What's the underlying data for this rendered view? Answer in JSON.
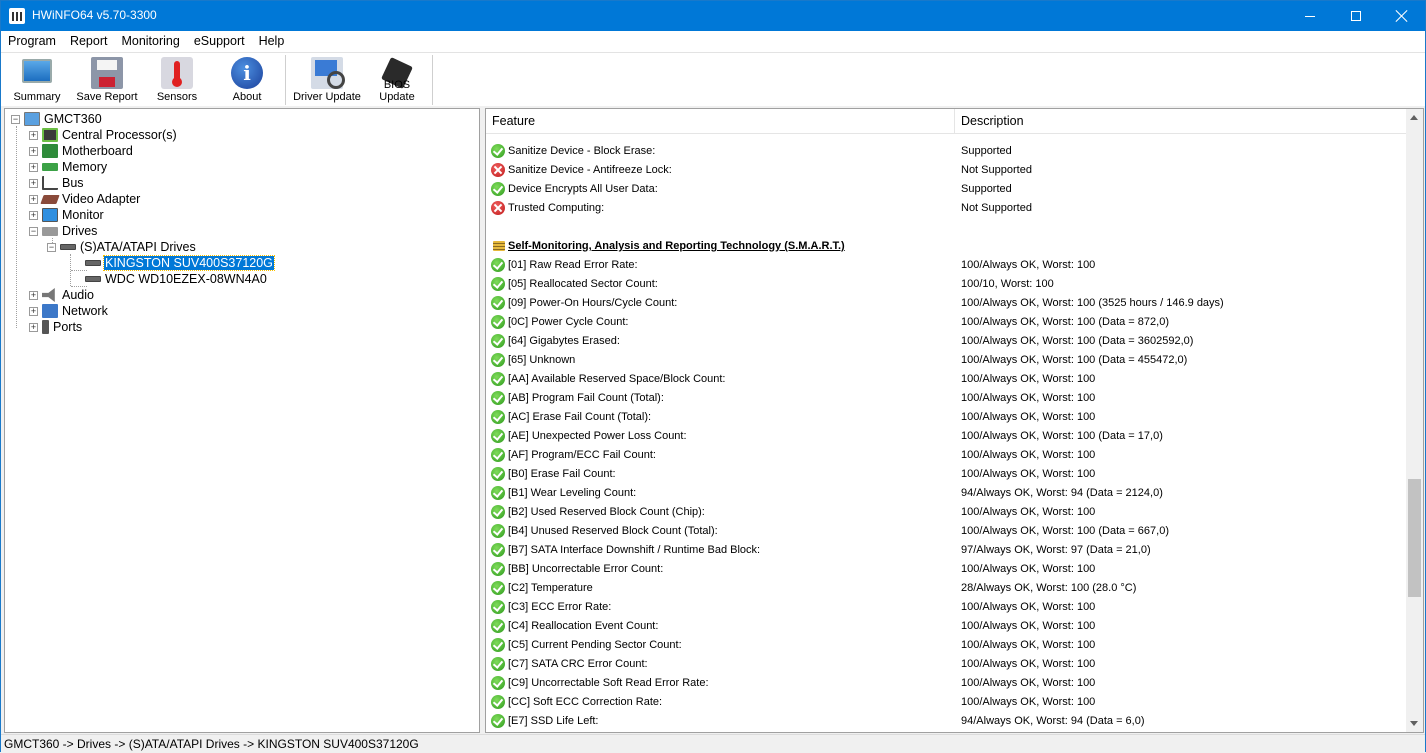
{
  "window": {
    "title": "HWiNFO64 v5.70-3300",
    "controls": [
      "minimize",
      "maximize",
      "close"
    ]
  },
  "menu": [
    "Program",
    "Report",
    "Monitoring",
    "eSupport",
    "Help"
  ],
  "toolbar": {
    "buttons": [
      {
        "label": "Summary",
        "icon": "monitor-icon"
      },
      {
        "label": "Save Report",
        "icon": "floppy-icon"
      },
      {
        "label": "Sensors",
        "icon": "thermometer-icon"
      },
      {
        "label": "About",
        "icon": "info-icon"
      },
      {
        "label": "Driver Update",
        "icon": "driver-update-icon"
      },
      {
        "label": "BIOS Update",
        "icon": "chip-icon"
      }
    ]
  },
  "tree": {
    "root": "GMCT360",
    "items": [
      {
        "label": "Central Processor(s)",
        "icon": "cpu-icon"
      },
      {
        "label": "Motherboard",
        "icon": "motherboard-icon"
      },
      {
        "label": "Memory",
        "icon": "memory-icon"
      },
      {
        "label": "Bus",
        "icon": "bus-icon"
      },
      {
        "label": "Video Adapter",
        "icon": "video-card-icon"
      },
      {
        "label": "Monitor",
        "icon": "monitor-icon"
      },
      {
        "label": "Drives",
        "icon": "drives-icon"
      },
      {
        "label": "(S)ATA/ATAPI Drives",
        "icon": "drive-icon"
      },
      {
        "label": "KINGSTON SUV400S37120G",
        "icon": "drive-icon",
        "selected": true
      },
      {
        "label": "WDC WD10EZEX-08WN4A0",
        "icon": "drive-icon"
      },
      {
        "label": "Audio",
        "icon": "speaker-icon"
      },
      {
        "label": "Network",
        "icon": "network-icon"
      },
      {
        "label": "Ports",
        "icon": "port-icon"
      }
    ]
  },
  "detail": {
    "columns": [
      "Feature",
      "Description"
    ],
    "rows": [
      {
        "status": "ok",
        "feature": "Sanitize Device - Block Erase:",
        "desc": "Supported"
      },
      {
        "status": "bad",
        "feature": "Sanitize Device - Antifreeze Lock:",
        "desc": "Not Supported"
      },
      {
        "status": "ok",
        "feature": "Device Encrypts All User Data:",
        "desc": "Supported"
      },
      {
        "status": "bad",
        "feature": "Trusted Computing:",
        "desc": "Not Supported"
      },
      {
        "status": "none",
        "feature": "",
        "desc": ""
      },
      {
        "status": "section",
        "feature": "Self-Monitoring, Analysis and Reporting Technology (S.M.A.R.T.)",
        "desc": ""
      },
      {
        "status": "ok",
        "feature": "[01] Raw Read Error Rate:",
        "desc": "100/Always OK, Worst: 100"
      },
      {
        "status": "ok",
        "feature": "[05] Reallocated Sector Count:",
        "desc": "100/10, Worst: 100"
      },
      {
        "status": "ok",
        "feature": "[09] Power-On Hours/Cycle Count:",
        "desc": "100/Always OK, Worst: 100 (3525 hours / 146.9 days)"
      },
      {
        "status": "ok",
        "feature": "[0C] Power Cycle Count:",
        "desc": "100/Always OK, Worst: 100 (Data = 872,0)"
      },
      {
        "status": "ok",
        "feature": "[64] Gigabytes Erased:",
        "desc": "100/Always OK, Worst: 100 (Data = 3602592,0)"
      },
      {
        "status": "ok",
        "feature": "[65] Unknown",
        "desc": "100/Always OK, Worst: 100 (Data = 455472,0)"
      },
      {
        "status": "ok",
        "feature": "[AA] Available Reserved Space/Block Count:",
        "desc": "100/Always OK, Worst: 100"
      },
      {
        "status": "ok",
        "feature": "[AB] Program Fail Count (Total):",
        "desc": "100/Always OK, Worst: 100"
      },
      {
        "status": "ok",
        "feature": "[AC] Erase Fail Count (Total):",
        "desc": "100/Always OK, Worst: 100"
      },
      {
        "status": "ok",
        "feature": "[AE] Unexpected Power Loss Count:",
        "desc": "100/Always OK, Worst: 100 (Data = 17,0)"
      },
      {
        "status": "ok",
        "feature": "[AF] Program/ECC Fail Count:",
        "desc": "100/Always OK, Worst: 100"
      },
      {
        "status": "ok",
        "feature": "[B0] Erase Fail Count:",
        "desc": "100/Always OK, Worst: 100"
      },
      {
        "status": "ok",
        "feature": "[B1] Wear Leveling Count:",
        "desc": "94/Always OK, Worst: 94 (Data = 2124,0)"
      },
      {
        "status": "ok",
        "feature": "[B2] Used Reserved Block Count (Chip):",
        "desc": "100/Always OK, Worst: 100"
      },
      {
        "status": "ok",
        "feature": "[B4] Unused Reserved Block Count (Total):",
        "desc": "100/Always OK, Worst: 100 (Data = 667,0)"
      },
      {
        "status": "ok",
        "feature": "[B7] SATA Interface Downshift / Runtime Bad Block:",
        "desc": "97/Always OK, Worst: 97 (Data = 21,0)"
      },
      {
        "status": "ok",
        "feature": "[BB] Uncorrectable Error Count:",
        "desc": "100/Always OK, Worst: 100"
      },
      {
        "status": "ok",
        "feature": "[C2] Temperature",
        "desc": "28/Always OK, Worst: 100 (28.0 °C)"
      },
      {
        "status": "ok",
        "feature": "[C3] ECC Error Rate:",
        "desc": "100/Always OK, Worst: 100"
      },
      {
        "status": "ok",
        "feature": "[C4] Reallocation Event Count:",
        "desc": "100/Always OK, Worst: 100"
      },
      {
        "status": "ok",
        "feature": "[C5] Current Pending Sector Count:",
        "desc": "100/Always OK, Worst: 100"
      },
      {
        "status": "ok",
        "feature": "[C7] SATA CRC Error Count:",
        "desc": "100/Always OK, Worst: 100"
      },
      {
        "status": "ok",
        "feature": "[C9] Uncorrectable Soft Read Error Rate:",
        "desc": "100/Always OK, Worst: 100"
      },
      {
        "status": "ok",
        "feature": "[CC] Soft ECC Correction Rate:",
        "desc": "100/Always OK, Worst: 100"
      },
      {
        "status": "ok",
        "feature": "[E7] SSD Life Left:",
        "desc": "94/Always OK, Worst: 94 (Data = 6,0)"
      }
    ]
  },
  "statusbar": "GMCT360 -> Drives -> (S)ATA/ATAPI Drives -> KINGSTON SUV400S37120G",
  "colors": {
    "accent": "#0078d7",
    "ok": "#2e9a1e",
    "bad": "#c01a1a"
  }
}
